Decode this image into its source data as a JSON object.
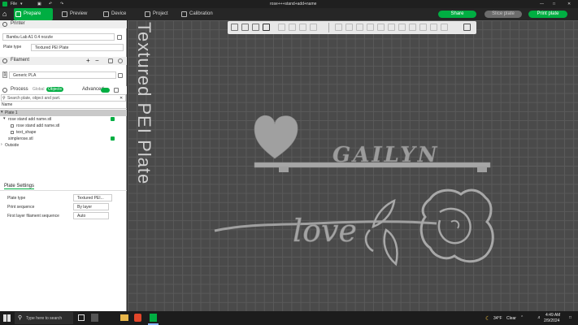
{
  "titlebar": {
    "menu_label": "File",
    "window_title": "rose+++stand+add+name"
  },
  "tabs": {
    "prepare": "Prepare",
    "preview": "Preview",
    "device": "Device",
    "project": "Project",
    "calibration": "Calibration"
  },
  "actions": {
    "share": "Share",
    "slice_plate": "Slice plate",
    "print_plate": "Print plate"
  },
  "printer": {
    "section_title": "Printer",
    "printer_name": "Bambu Lab A1 0.4 nozzle",
    "plate_type_label": "Plate type",
    "plate_type_value": "Textured PEI Plate"
  },
  "filament": {
    "section_title": "Filament",
    "slot_number": "1",
    "material": "Generic PLA"
  },
  "process": {
    "section_title": "Process",
    "global_label": "Global",
    "objects_label": "Objects",
    "advanced_label": "Advanced",
    "search_placeholder": "Search plate, object and part."
  },
  "object_list": {
    "column_name": "Name",
    "rows": [
      {
        "label": "Plate 1"
      },
      {
        "label": "rose stand add name.stl"
      },
      {
        "label": "rose stand add name.stl"
      },
      {
        "label": "text_shape"
      },
      {
        "label": "simplerose.stl"
      },
      {
        "label": "Outside"
      }
    ]
  },
  "plate_settings": {
    "title": "Plate Settings",
    "plate_type_label": "Plate type",
    "plate_type_value": "Textured PEI...",
    "print_sequence_label": "Print sequence",
    "print_sequence_value": "By layer",
    "first_layer_label": "First layer filament sequence",
    "first_layer_value": "Auto"
  },
  "canvas": {
    "bed_label": "Textured PEI Plate",
    "model_name_text": "GAILYN",
    "model_love_text": "love"
  },
  "taskbar": {
    "search_placeholder": "Type here to search",
    "temperature": "34°F",
    "weather": "Clear",
    "time": "4:49 AM",
    "date": "2/9/2024"
  },
  "colors": {
    "accent": "#00ae42",
    "canvas_bg": "#4a4a4a",
    "model_gray": "#a0a0a0"
  }
}
